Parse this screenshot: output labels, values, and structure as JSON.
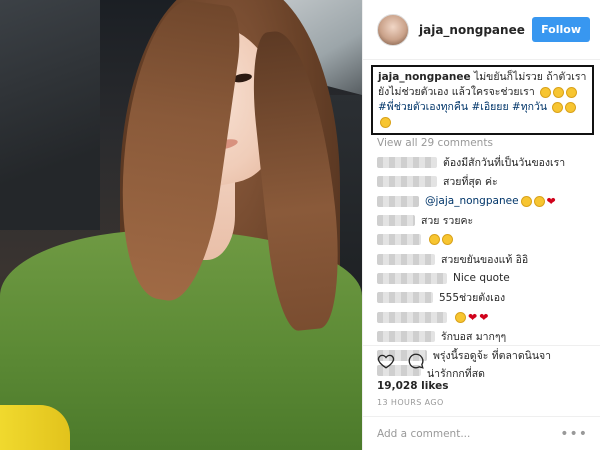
{
  "post": {
    "username": "jaja_nongpanee",
    "follow_label": "Follow",
    "caption": {
      "user": "jaja_nongpanee",
      "text": "ไม่ขยันก็ไม่รวย ถ้าตัวเรายังไม่ช่วยตัวเอง แล้วใครจะช่วยเรา",
      "tags": "#พี่ช่วยตัวเองทุกคืน #เอิยยย #ทุกวัน"
    },
    "view_all": "View all 29 comments",
    "comments": [
      {
        "text": "ต้องมีสักวันที่เป็นวันของเรา",
        "blur": 60
      },
      {
        "text": "สวยที่สุด ค่ะ",
        "blur": 60
      },
      {
        "text": "@jaja_nongpanee",
        "blur": 42
      },
      {
        "text": "สวย รวยคะ",
        "blur": 38
      },
      {
        "text": "",
        "blur": 44
      },
      {
        "text": "สวยขยันของแท้ อิอิ",
        "blur": 58
      },
      {
        "text": "Nice quote",
        "blur": 70
      },
      {
        "text": "555ช่วยตังเอง",
        "blur": 56
      },
      {
        "text": "",
        "blur": 70
      },
      {
        "text": "รักบอส มากๆๆ",
        "blur": 58
      },
      {
        "text": "พรุ่งนี้รอดูจ้ะ ที่ตลาดนินจา",
        "blur": 50
      },
      {
        "text": "น่ารักกกที่สุด",
        "blur": 44
      }
    ],
    "likes": "19,028 likes",
    "timestamp": "13 HOURS AGO",
    "add_comment_placeholder": "Add a comment...",
    "more_label": "•••"
  },
  "colors": {
    "follow_bg": "#3897f0",
    "link": "#003569",
    "muted": "#999999"
  },
  "icons": [
    "heart-outline-icon",
    "comment-bubble-icon",
    "more-options-icon"
  ]
}
